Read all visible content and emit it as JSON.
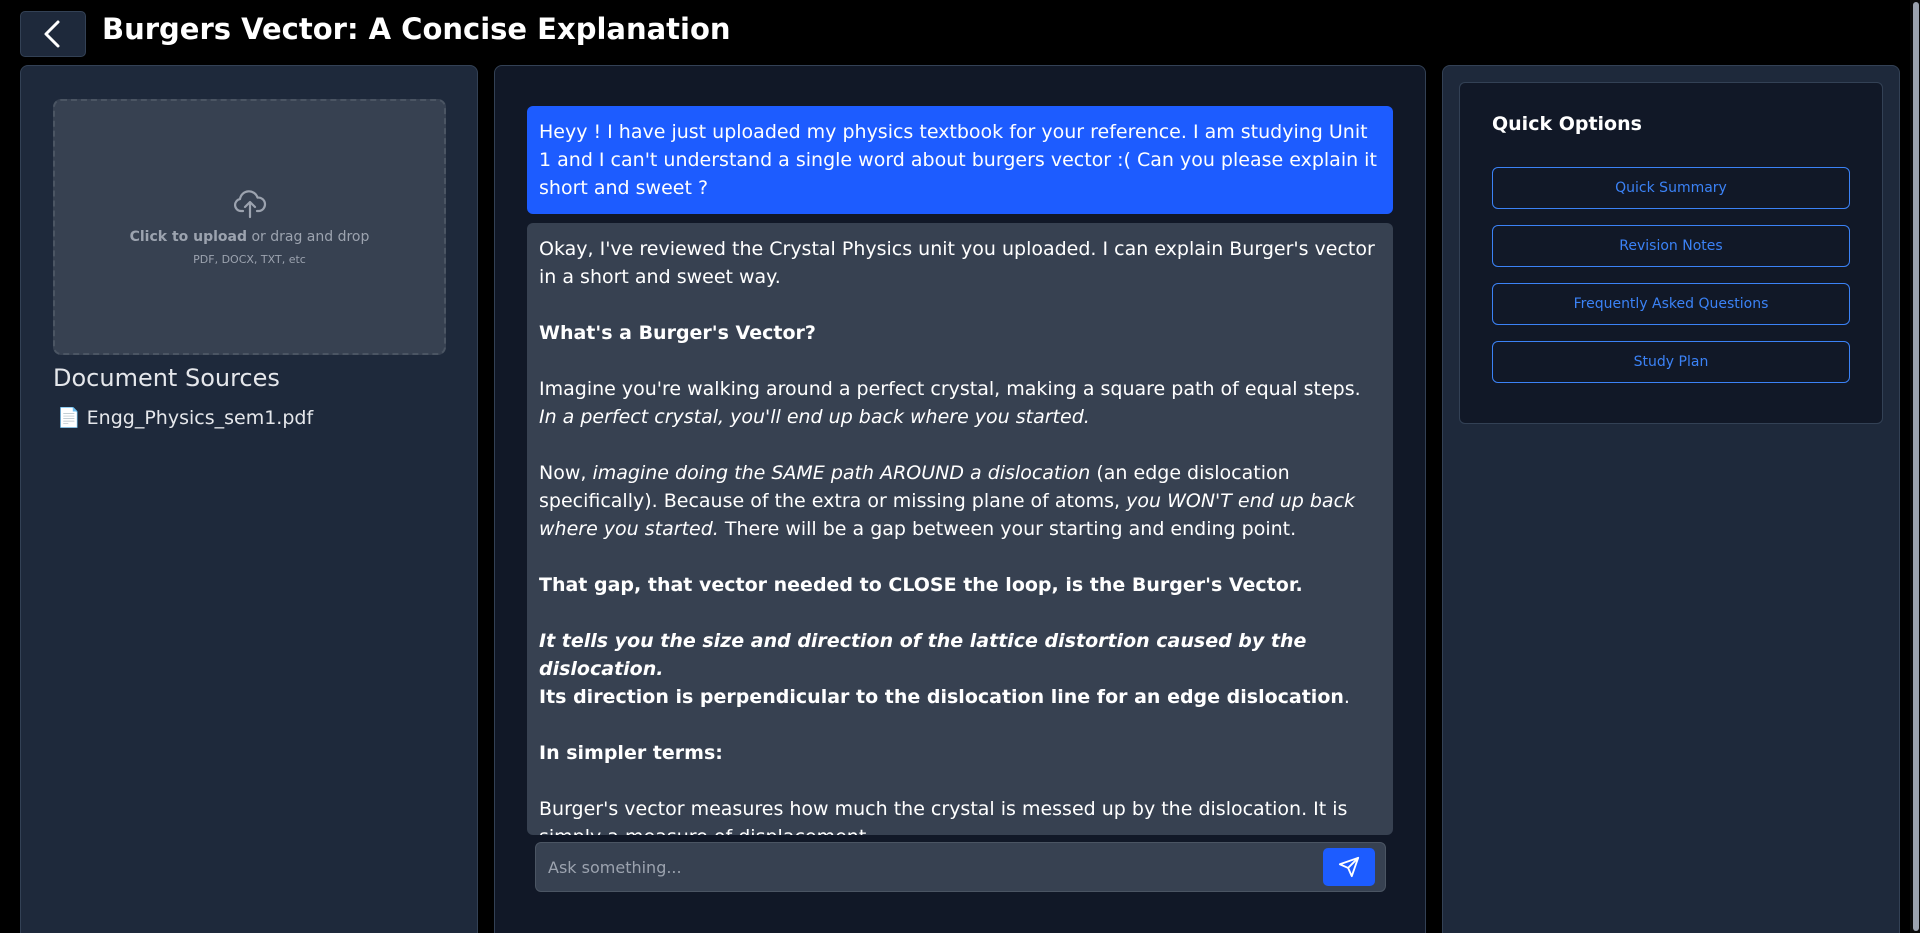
{
  "header": {
    "title": "Burgers Vector: A Concise Explanation",
    "back_icon": "chevron-left-icon"
  },
  "sidebar": {
    "upload": {
      "icon": "cloud-upload-icon",
      "click_label": "Click to upload",
      "drag_label": " or drag and drop",
      "hint": "PDF, DOCX, TXT, etc"
    },
    "sources_title": "Document Sources",
    "sources": [
      {
        "icon": "document-icon",
        "glyph": "📄",
        "name": "Engg_Physics_sem1.pdf"
      }
    ]
  },
  "chat": {
    "user_message": "Heyy ! I have just uploaded my physics textbook for your reference. I am studying Unit 1 and I can't understand a single word about burgers vector :( Can you please explain it short and sweet ?",
    "ai": {
      "intro": "Okay, I've reviewed the Crystal Physics unit you uploaded. I can explain Burger's vector in a short and sweet way.",
      "heading": "What's a Burger's Vector?",
      "p1_plain": "Imagine you're walking around a perfect crystal, making a square path of equal steps. ",
      "p1_italic": "In a perfect crystal, you'll end up back where you started.",
      "p2_a": "Now, ",
      "p2_italic1": "imagine doing the SAME path AROUND a dislocation",
      "p2_b": " (an edge dislocation specifically). Because of the extra or missing plane of atoms, ",
      "p2_italic2": "you WON'T end up back where you started.",
      "p2_c": " There will be a gap between your starting and ending point.",
      "p3_bold": "That gap, that vector needed to CLOSE the loop, is the Burger's Vector.",
      "p4_bold_italic": "It tells you the size and direction of the lattice distortion caused by the dislocation.",
      "p5_bold": "Its direction is perpendicular to the dislocation line for an edge dislocation",
      "p5_end": ".",
      "p6_bold": "In simpler terms:",
      "p7": "Burger's vector measures how much the crystal is messed up by the dislocation. It is simply a measure of displacement."
    },
    "input": {
      "value": "",
      "placeholder": "Ask something..."
    },
    "send_icon": "send-icon"
  },
  "quick_options": {
    "title": "Quick Options",
    "buttons": [
      {
        "label": "Quick Summary"
      },
      {
        "label": "Revision Notes"
      },
      {
        "label": "Frequently Asked Questions"
      },
      {
        "label": "Study Plan"
      }
    ]
  },
  "colors": {
    "background": "#000000",
    "panel": "#1e293b",
    "chat_panel": "#111827",
    "user_bubble": "#1d5cff",
    "ai_bubble": "#374151",
    "accent": "#3b82f6"
  }
}
